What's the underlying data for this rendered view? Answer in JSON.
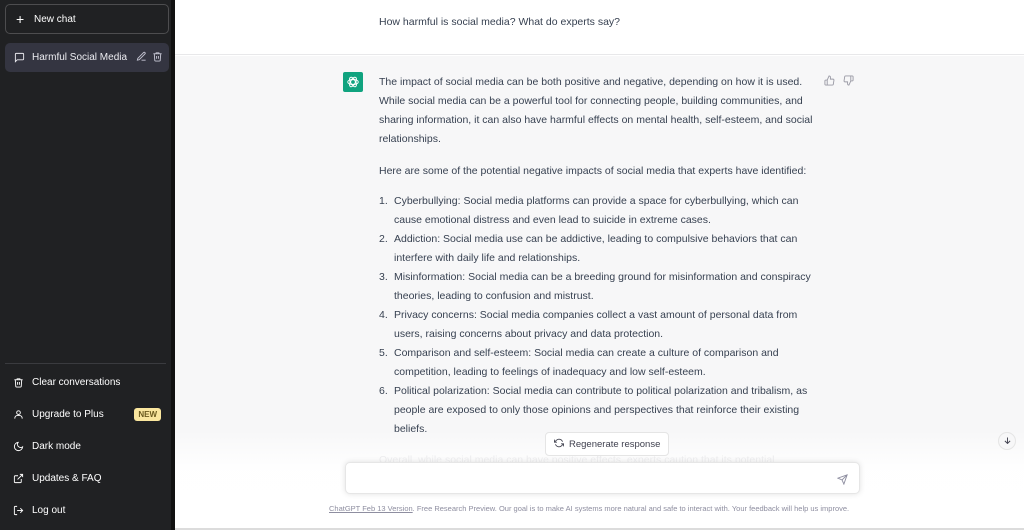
{
  "sidebar": {
    "new_chat_label": "New chat",
    "conversations": [
      {
        "title": "Harmful Social Media"
      }
    ],
    "menu": [
      {
        "label": "Clear conversations",
        "icon": "trash-icon"
      },
      {
        "label": "Upgrade to Plus",
        "icon": "user-icon",
        "badge": "NEW"
      },
      {
        "label": "Dark mode",
        "icon": "moon-icon"
      },
      {
        "label": "Updates & FAQ",
        "icon": "external-link-icon"
      },
      {
        "label": "Log out",
        "icon": "logout-icon"
      }
    ]
  },
  "chat": {
    "user_message": "How harmful is social media? What do experts say?",
    "assistant": {
      "intro": "The impact of social media can be both positive and negative, depending on how it is used. While social media can be a powerful tool for connecting people, building communities, and sharing information, it can also have harmful effects on mental health, self-esteem, and social relationships.",
      "lead": "Here are some of the potential negative impacts of social media that experts have identified:",
      "items": [
        {
          "num": "1.",
          "text": "Cyberbullying: Social media platforms can provide a space for cyberbullying, which can cause emotional distress and even lead to suicide in extreme cases."
        },
        {
          "num": "2.",
          "text": "Addiction: Social media use can be addictive, leading to compulsive behaviors that can interfere with daily life and relationships."
        },
        {
          "num": "3.",
          "text": "Misinformation: Social media can be a breeding ground for misinformation and conspiracy theories, leading to confusion and mistrust."
        },
        {
          "num": "4.",
          "text": "Privacy concerns: Social media companies collect a vast amount of personal data from users, raising concerns about privacy and data protection."
        },
        {
          "num": "5.",
          "text": "Comparison and self-esteem: Social media can create a culture of comparison and competition, leading to feelings of inadequacy and low self-esteem."
        },
        {
          "num": "6.",
          "text": "Political polarization: Social media can contribute to political polarization and tribalism, as people are exposed to only those opinions and perspectives that reinforce their existing beliefs."
        }
      ],
      "conclusion_partial": "Overall, while social media can have positive effects, experts caution that its potential"
    }
  },
  "composer": {
    "regenerate_label": "Regenerate response",
    "input_value": "",
    "input_placeholder": ""
  },
  "footer": {
    "version_link": "ChatGPT Feb 13 Version",
    "text": ". Free Research Preview. Our goal is to make AI systems more natural and safe to interact with. Your feedback will help us improve."
  },
  "colors": {
    "sidebar_bg": "#202123",
    "active_item_bg": "#343541",
    "brand_green": "#10a37f",
    "badge_bg": "#fae69e"
  }
}
